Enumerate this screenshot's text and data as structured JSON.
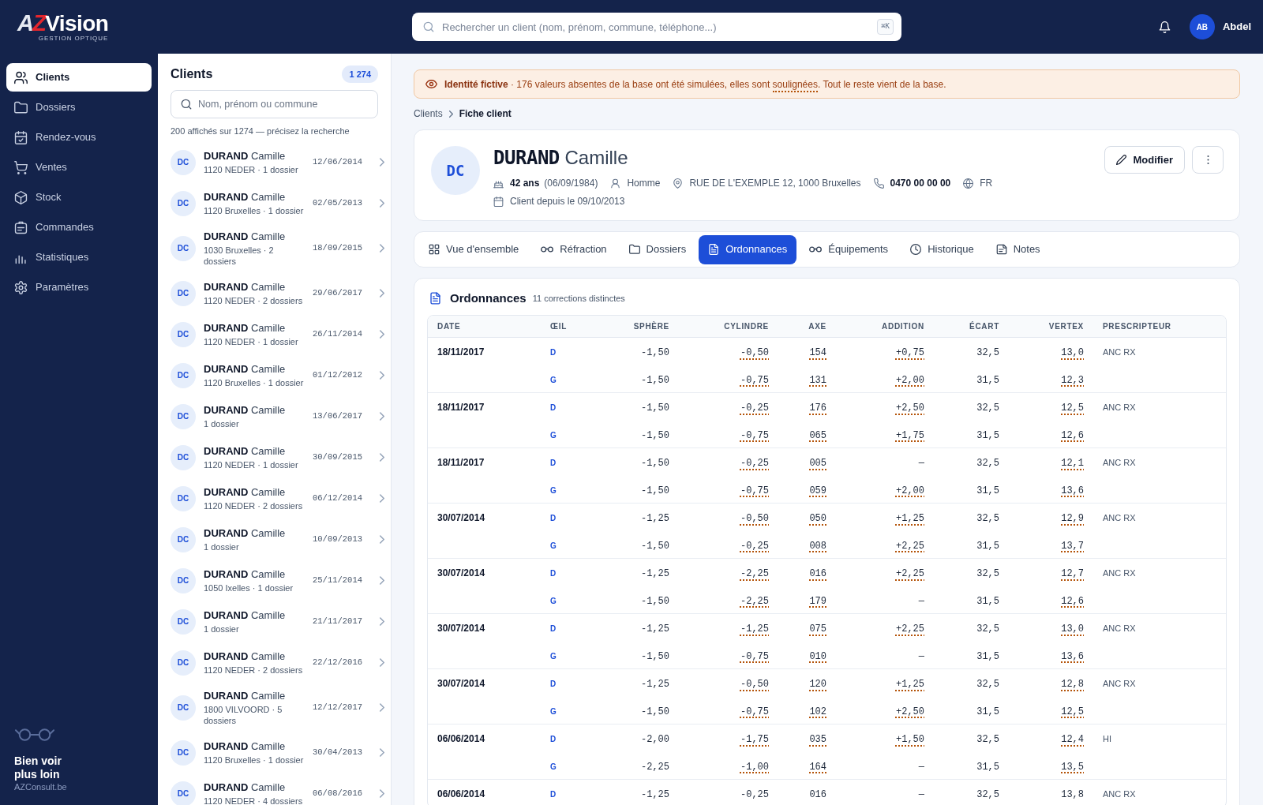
{
  "topbar": {
    "logo": {
      "mark": "AZ",
      "name": "Vision",
      "tagline": "GESTION OPTIQUE"
    },
    "search": {
      "placeholder": "Rechercher un client (nom, prénom, commune, téléphone...)",
      "shortcut": "⌘K"
    },
    "user": {
      "initials": "AB",
      "name": "Abdel"
    }
  },
  "sidebar": {
    "items": [
      {
        "label": "Clients",
        "selected": true
      },
      {
        "label": "Dossiers",
        "selected": false
      },
      {
        "label": "Rendez-vous",
        "selected": false
      },
      {
        "label": "Ventes",
        "selected": false
      },
      {
        "label": "Stock",
        "selected": false
      },
      {
        "label": "Commandes",
        "selected": false
      },
      {
        "label": "Statistiques",
        "selected": false
      },
      {
        "label": "Paramètres",
        "selected": false
      }
    ],
    "footer": {
      "tagline": "Bien voir plus loin",
      "site": "AZConsult.be"
    }
  },
  "client_list": {
    "title": "Clients",
    "count": "1 274",
    "search": {
      "placeholder": "Nom, prénom ou commune"
    },
    "caption": "200 affichés sur 1274 — précisez la recherche",
    "clients": [
      {
        "initials": "DC",
        "last_name": "DURAND",
        "first_name": "Camille",
        "details": "1120 NEDER · 1 dossier",
        "date": "12/06/2014"
      },
      {
        "initials": "DC",
        "last_name": "DURAND",
        "first_name": "Camille",
        "details": "1120 Bruxelles · 1 dossier",
        "date": "02/05/2013"
      },
      {
        "initials": "DC",
        "last_name": "DURAND",
        "first_name": "Camille",
        "details": "1030 Bruxelles · 2 dossiers",
        "date": "18/09/2015"
      },
      {
        "initials": "DC",
        "last_name": "DURAND",
        "first_name": "Camille",
        "details": "1120 NEDER · 2 dossiers",
        "date": "29/06/2017"
      },
      {
        "initials": "DC",
        "last_name": "DURAND",
        "first_name": "Camille",
        "details": "1120 NEDER · 1 dossier",
        "date": "26/11/2014"
      },
      {
        "initials": "DC",
        "last_name": "DURAND",
        "first_name": "Camille",
        "details": "1120 Bruxelles · 1 dossier",
        "date": "01/12/2012"
      },
      {
        "initials": "DC",
        "last_name": "DURAND",
        "first_name": "Camille",
        "details": "1 dossier",
        "date": "13/06/2017"
      },
      {
        "initials": "DC",
        "last_name": "DURAND",
        "first_name": "Camille",
        "details": "1120 NEDER · 1 dossier",
        "date": "30/09/2015"
      },
      {
        "initials": "DC",
        "last_name": "DURAND",
        "first_name": "Camille",
        "details": "1120 NEDER · 2 dossiers",
        "date": "06/12/2014"
      },
      {
        "initials": "DC",
        "last_name": "DURAND",
        "first_name": "Camille",
        "details": "1 dossier",
        "date": "10/09/2013"
      },
      {
        "initials": "DC",
        "last_name": "DURAND",
        "first_name": "Camille",
        "details": "1050 Ixelles · 1 dossier",
        "date": "25/11/2014"
      },
      {
        "initials": "DC",
        "last_name": "DURAND",
        "first_name": "Camille",
        "details": "1 dossier",
        "date": "21/11/2017"
      },
      {
        "initials": "DC",
        "last_name": "DURAND",
        "first_name": "Camille",
        "details": "1120 NEDER · 2 dossiers",
        "date": "22/12/2016"
      },
      {
        "initials": "DC",
        "last_name": "DURAND",
        "first_name": "Camille",
        "details": "1800 VILVOORD · 5 dossiers",
        "date": "12/12/2017"
      },
      {
        "initials": "DC",
        "last_name": "DURAND",
        "first_name": "Camille",
        "details": "1120 Bruxelles · 1 dossier",
        "date": "30/04/2013"
      },
      {
        "initials": "DC",
        "last_name": "DURAND",
        "first_name": "Camille",
        "details": "1120 NEDER · 4 dossiers",
        "date": "06/08/2016"
      }
    ]
  },
  "notice": {
    "parts": [
      {
        "text": "**Identité fictive** · 176 valeurs absentes de la base ont été simulées, elles sont ",
        "underlined": false
      },
      {
        "text": "soulignées",
        "underlined": true
      },
      {
        "text": ". Tout le reste vient de la base.",
        "underlined": false
      }
    ]
  },
  "breadcrumb": [
    {
      "label": "Clients",
      "current": false
    },
    {
      "label": "Fiche client",
      "current": true
    }
  ],
  "client": {
    "initials": "DC",
    "last_name": "DURAND",
    "first_name": "Camille",
    "age": "42 ans",
    "birth_date": "(06/09/1984)",
    "gender": "Homme",
    "address": "RUE DE L'EXEMPLE 12, 1000 Bruxelles",
    "phone": "0470 00 00 00",
    "language": "FR",
    "since": "Client depuis le 09/10/2013",
    "edit_label": "Modifier"
  },
  "tabs": [
    {
      "label": "Vue d'ensemble",
      "selected": false
    },
    {
      "label": "Réfraction",
      "selected": false
    },
    {
      "label": "Dossiers",
      "selected": false
    },
    {
      "label": "Ordonnances",
      "selected": true
    },
    {
      "label": "Équipements",
      "selected": false
    },
    {
      "label": "Historique",
      "selected": false
    },
    {
      "label": "Notes",
      "selected": false
    }
  ],
  "prescriptions": {
    "title": "Ordonnances",
    "subtitle": "11 corrections distinctes",
    "columns": [
      "DATE",
      "ŒIL",
      "SPHÈRE",
      "CYLINDRE",
      "AXE",
      "ADDITION",
      "ÉCART",
      "VERTEX",
      "PRESCRIPTEUR"
    ],
    "groups": [
      {
        "date": "18/11/2017",
        "prescriber": "ANC RX",
        "eyes": [
          {
            "eye": "D",
            "values": [
              {
                "text": "-1,50",
                "simulated": false
              },
              {
                "text": "-0,50",
                "simulated": true
              },
              {
                "text": "154",
                "simulated": true
              },
              {
                "text": "+0,75",
                "simulated": true
              },
              {
                "text": "32,5",
                "simulated": false
              },
              {
                "text": "13,0",
                "simulated": true
              }
            ]
          },
          {
            "eye": "G",
            "values": [
              {
                "text": "-1,50",
                "simulated": false
              },
              {
                "text": "-0,75",
                "simulated": true
              },
              {
                "text": "131",
                "simulated": true
              },
              {
                "text": "+2,00",
                "simulated": true
              },
              {
                "text": "31,5",
                "simulated": false
              },
              {
                "text": "12,3",
                "simulated": true
              }
            ]
          }
        ]
      },
      {
        "date": "18/11/2017",
        "prescriber": "ANC RX",
        "eyes": [
          {
            "eye": "D",
            "values": [
              {
                "text": "-1,50",
                "simulated": false
              },
              {
                "text": "-0,25",
                "simulated": true
              },
              {
                "text": "176",
                "simulated": true
              },
              {
                "text": "+2,50",
                "simulated": true
              },
              {
                "text": "32,5",
                "simulated": false
              },
              {
                "text": "12,5",
                "simulated": true
              }
            ]
          },
          {
            "eye": "G",
            "values": [
              {
                "text": "-1,50",
                "simulated": false
              },
              {
                "text": "-0,75",
                "simulated": true
              },
              {
                "text": "065",
                "simulated": true
              },
              {
                "text": "+1,75",
                "simulated": true
              },
              {
                "text": "31,5",
                "simulated": false
              },
              {
                "text": "12,6",
                "simulated": true
              }
            ]
          }
        ]
      },
      {
        "date": "18/11/2017",
        "prescriber": "ANC RX",
        "eyes": [
          {
            "eye": "D",
            "values": [
              {
                "text": "-1,50",
                "simulated": false
              },
              {
                "text": "-0,25",
                "simulated": true
              },
              {
                "text": "005",
                "simulated": true
              },
              {
                "text": "—",
                "simulated": false
              },
              {
                "text": "32,5",
                "simulated": false
              },
              {
                "text": "12,1",
                "simulated": true
              }
            ]
          },
          {
            "eye": "G",
            "values": [
              {
                "text": "-1,50",
                "simulated": false
              },
              {
                "text": "-0,75",
                "simulated": true
              },
              {
                "text": "059",
                "simulated": true
              },
              {
                "text": "+2,00",
                "simulated": true
              },
              {
                "text": "31,5",
                "simulated": false
              },
              {
                "text": "13,6",
                "simulated": true
              }
            ]
          }
        ]
      },
      {
        "date": "30/07/2014",
        "prescriber": "ANC RX",
        "eyes": [
          {
            "eye": "D",
            "values": [
              {
                "text": "-1,25",
                "simulated": false
              },
              {
                "text": "-0,50",
                "simulated": true
              },
              {
                "text": "050",
                "simulated": true
              },
              {
                "text": "+1,25",
                "simulated": true
              },
              {
                "text": "32,5",
                "simulated": false
              },
              {
                "text": "12,9",
                "simulated": true
              }
            ]
          },
          {
            "eye": "G",
            "values": [
              {
                "text": "-1,50",
                "simulated": false
              },
              {
                "text": "-0,25",
                "simulated": true
              },
              {
                "text": "008",
                "simulated": true
              },
              {
                "text": "+2,25",
                "simulated": true
              },
              {
                "text": "31,5",
                "simulated": false
              },
              {
                "text": "13,7",
                "simulated": true
              }
            ]
          }
        ]
      },
      {
        "date": "30/07/2014",
        "prescriber": "ANC RX",
        "eyes": [
          {
            "eye": "D",
            "values": [
              {
                "text": "-1,25",
                "simulated": false
              },
              {
                "text": "-2,25",
                "simulated": true
              },
              {
                "text": "016",
                "simulated": true
              },
              {
                "text": "+2,25",
                "simulated": true
              },
              {
                "text": "32,5",
                "simulated": false
              },
              {
                "text": "12,7",
                "simulated": true
              }
            ]
          },
          {
            "eye": "G",
            "values": [
              {
                "text": "-1,50",
                "simulated": false
              },
              {
                "text": "-2,25",
                "simulated": true
              },
              {
                "text": "179",
                "simulated": true
              },
              {
                "text": "—",
                "simulated": false
              },
              {
                "text": "31,5",
                "simulated": false
              },
              {
                "text": "12,6",
                "simulated": true
              }
            ]
          }
        ]
      },
      {
        "date": "30/07/2014",
        "prescriber": "ANC RX",
        "eyes": [
          {
            "eye": "D",
            "values": [
              {
                "text": "-1,25",
                "simulated": false
              },
              {
                "text": "-1,25",
                "simulated": true
              },
              {
                "text": "075",
                "simulated": true
              },
              {
                "text": "+2,25",
                "simulated": true
              },
              {
                "text": "32,5",
                "simulated": false
              },
              {
                "text": "13,0",
                "simulated": true
              }
            ]
          },
          {
            "eye": "G",
            "values": [
              {
                "text": "-1,50",
                "simulated": false
              },
              {
                "text": "-0,75",
                "simulated": true
              },
              {
                "text": "010",
                "simulated": true
              },
              {
                "text": "—",
                "simulated": false
              },
              {
                "text": "31,5",
                "simulated": false
              },
              {
                "text": "13,6",
                "simulated": true
              }
            ]
          }
        ]
      },
      {
        "date": "30/07/2014",
        "prescriber": "ANC RX",
        "eyes": [
          {
            "eye": "D",
            "values": [
              {
                "text": "-1,25",
                "simulated": false
              },
              {
                "text": "-0,50",
                "simulated": true
              },
              {
                "text": "120",
                "simulated": true
              },
              {
                "text": "+1,25",
                "simulated": true
              },
              {
                "text": "32,5",
                "simulated": false
              },
              {
                "text": "12,8",
                "simulated": true
              }
            ]
          },
          {
            "eye": "G",
            "values": [
              {
                "text": "-1,50",
                "simulated": false
              },
              {
                "text": "-0,75",
                "simulated": true
              },
              {
                "text": "102",
                "simulated": true
              },
              {
                "text": "+2,50",
                "simulated": true
              },
              {
                "text": "31,5",
                "simulated": false
              },
              {
                "text": "12,5",
                "simulated": true
              }
            ]
          }
        ]
      },
      {
        "date": "06/06/2014",
        "prescriber": "HI",
        "eyes": [
          {
            "eye": "D",
            "values": [
              {
                "text": "-2,00",
                "simulated": false
              },
              {
                "text": "-1,75",
                "simulated": true
              },
              {
                "text": "035",
                "simulated": true
              },
              {
                "text": "+1,50",
                "simulated": true
              },
              {
                "text": "32,5",
                "simulated": false
              },
              {
                "text": "12,4",
                "simulated": true
              }
            ]
          },
          {
            "eye": "G",
            "values": [
              {
                "text": "-2,25",
                "simulated": false
              },
              {
                "text": "-1,00",
                "simulated": true
              },
              {
                "text": "164",
                "simulated": true
              },
              {
                "text": "—",
                "simulated": false
              },
              {
                "text": "31,5",
                "simulated": false
              },
              {
                "text": "13,5",
                "simulated": true
              }
            ]
          }
        ]
      },
      {
        "date": "06/06/2014",
        "prescriber": "ANC RX",
        "eyes": [
          {
            "eye": "D",
            "values": [
              {
                "text": "-1,25"
              },
              {
                "text": "-0,25"
              },
              {
                "text": "016"
              },
              {
                "text": "—"
              },
              {
                "text": "32,5"
              },
              {
                "text": "13,8"
              }
            ]
          }
        ]
      }
    ]
  }
}
